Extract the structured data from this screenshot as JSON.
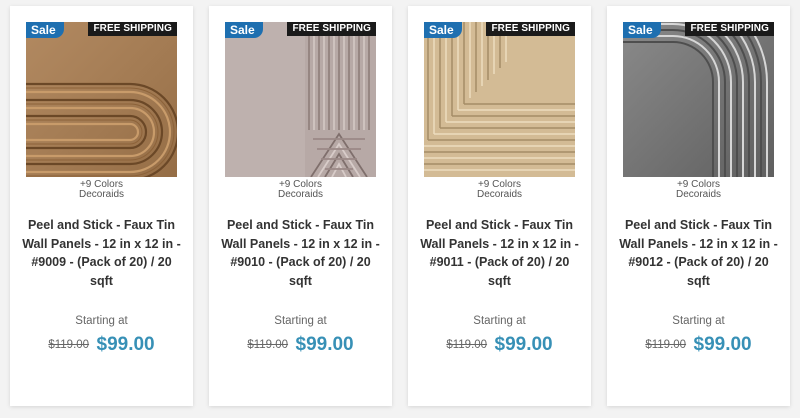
{
  "products": [
    {
      "sale_badge": "Sale",
      "shipping_badge": "FREE SHIPPING",
      "colors_text": "+9 Colors",
      "brand": "Decoraids",
      "title": "Peel and Stick - Faux Tin Wall Panels - 12 in x 12 in - #9009 - (Pack of 20) / 20 sqft",
      "starting_label": "Starting at",
      "old_price": "$119.00",
      "new_price": "$99.00",
      "image_color": "#a97c4f"
    },
    {
      "sale_badge": "Sale",
      "shipping_badge": "FREE SHIPPING",
      "colors_text": "+9 Colors",
      "brand": "Decoraids",
      "title": "Peel and Stick - Faux Tin Wall Panels - 12 in x 12 in - #9010 - (Pack of 20) / 20 sqft",
      "starting_label": "Starting at",
      "old_price": "$119.00",
      "new_price": "$99.00",
      "image_color": "#b7a9a6"
    },
    {
      "sale_badge": "Sale",
      "shipping_badge": "FREE SHIPPING",
      "colors_text": "+9 Colors",
      "brand": "Decoraids",
      "title": "Peel and Stick - Faux Tin Wall Panels - 12 in x 12 in - #9011 - (Pack of 20) / 20 sqft",
      "starting_label": "Starting at",
      "old_price": "$119.00",
      "new_price": "$99.00",
      "image_color": "#d3bb95"
    },
    {
      "sale_badge": "Sale",
      "shipping_badge": "FREE SHIPPING",
      "colors_text": "+9 Colors",
      "brand": "Decoraids",
      "title": "Peel and Stick - Faux Tin Wall Panels - 12 in x 12 in - #9012 - (Pack of 20) / 20 sqft",
      "starting_label": "Starting at",
      "old_price": "$119.00",
      "new_price": "$99.00",
      "image_color": "#7c7c7c"
    }
  ]
}
